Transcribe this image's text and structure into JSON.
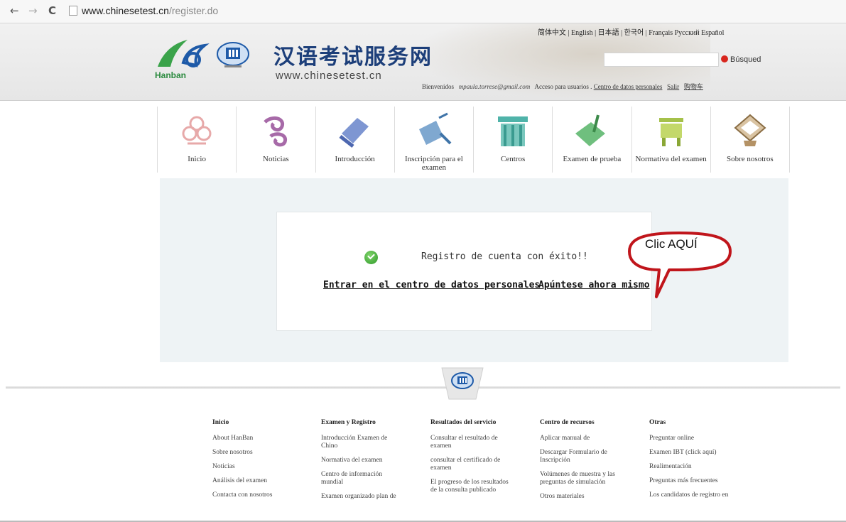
{
  "browser": {
    "back": "←",
    "forward": "→",
    "reload": "C",
    "url_domain": "www.chinesetest.cn",
    "url_path": "/register.do"
  },
  "header": {
    "hanban_logo_text": "Hanban",
    "site_title": "汉语考试服务网",
    "site_url": "www.chinesetest.cn",
    "languages": [
      "简体中文",
      "English",
      "日本語",
      "한국어",
      "Français",
      "Русский",
      "Español"
    ],
    "search_button": "Búsqued",
    "welcome": "Bienvenidos",
    "user_email": "mpaula.torrese@gmail.com",
    "user_access": "Acceso para usuarios .",
    "personal_center": "Centro de datos personales",
    "logout": "Salir",
    "cart": "购物车"
  },
  "nav": {
    "items": [
      {
        "label": "Inicio",
        "icon": "knot-icon"
      },
      {
        "label": "Noticias",
        "icon": "cloud-swirl-icon"
      },
      {
        "label": "Introducción",
        "icon": "scroll-icon"
      },
      {
        "label": "Inscripción para el examen",
        "icon": "brush-scroll-icon"
      },
      {
        "label": "Centros",
        "icon": "gate-icon"
      },
      {
        "label": "Examen de prueba",
        "icon": "brush-book-icon"
      },
      {
        "label": "Normativa del examen",
        "icon": "bronze-vessel-icon"
      },
      {
        "label": "Sobre nosotros",
        "icon": "lantern-icon"
      }
    ]
  },
  "main": {
    "success_message": "Registro de cuenta con éxito!!",
    "link_personal_center": "Entrar en el centro de datos personales",
    "link_register_now": "Apúntese ahora mismo",
    "callout": "Clic AQUÍ"
  },
  "footer": {
    "columns": [
      {
        "heading": "Inicio",
        "links": [
          "About HanBan",
          "Sobre nosotros",
          "Noticias",
          "Análisis del examen",
          "Contacta con nosotros"
        ]
      },
      {
        "heading": "Examen y Registro",
        "links": [
          "Introducción Examen de Chino",
          "Normativa del examen",
          "Centro de información mundial",
          "Examen organizado plan de"
        ]
      },
      {
        "heading": "Resultados del servicio",
        "links": [
          "Consultar el resultado de examen",
          "consultar el certificado de examen",
          "El progreso de los resultados de la consulta publicado"
        ]
      },
      {
        "heading": "Centro de recursos",
        "links": [
          "Aplicar manual de",
          "Descargar Formulario de Inscripción",
          "Volúmenes de muestra y las preguntas de simulación",
          "Otros materiales"
        ]
      },
      {
        "heading": "Otras",
        "links": [
          "Preguntar online",
          "Examen IBT (click aquí)",
          "Realimentación",
          "Preguntas más frecuentes",
          "Los candidatos de registro en"
        ]
      }
    ]
  },
  "colors": {
    "title_blue": "#1d3f7a",
    "hanban_green": "#2a8a3e",
    "callout_red": "#c0151b",
    "main_bg": "#eef3f5"
  }
}
